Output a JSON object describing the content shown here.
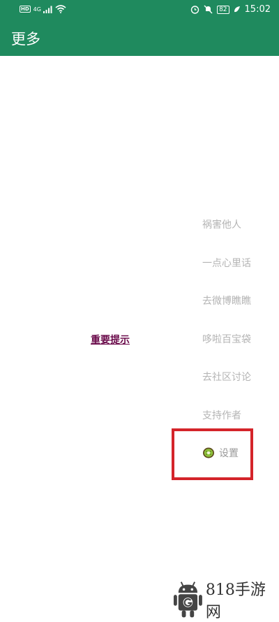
{
  "status_bar": {
    "hd_label": "HD",
    "network_label": "4G",
    "battery_level": "82",
    "time": "15:02",
    "icons": [
      "signal-icon",
      "wifi-icon",
      "alarm-icon",
      "mute-icon",
      "battery-icon",
      "leaf-icon"
    ]
  },
  "app_bar": {
    "title": "更多",
    "background_color": "#1f8a5e"
  },
  "main": {
    "notice_link": "重要提示",
    "menu_items": [
      {
        "label": "祸害他人"
      },
      {
        "label": "一点心里话"
      },
      {
        "label": "去微博瞧瞧"
      },
      {
        "label": "哆啦百宝袋"
      },
      {
        "label": "去社区讨论"
      },
      {
        "label": "支持作者"
      }
    ],
    "settings": {
      "label": "设置",
      "icon": "kiwi-icon"
    },
    "highlight_color": "#d4242a"
  },
  "watermark": {
    "text": "818手游网",
    "icon": "android-robot-icon"
  }
}
